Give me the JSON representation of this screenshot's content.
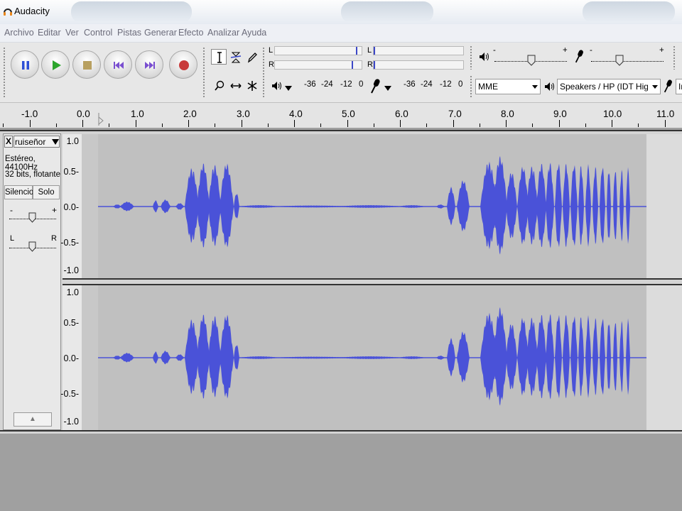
{
  "window": {
    "title": "Audacity"
  },
  "menu": [
    "Archivo",
    "Editar",
    "Ver",
    "Control",
    "Pistas",
    "Generar",
    "Efecto",
    "Analizar",
    "Ayuda"
  ],
  "meters": {
    "play_scale": [
      "-36",
      "-24",
      "-12",
      "0"
    ],
    "rec_scale": [
      "-36",
      "-24",
      "-12",
      "0"
    ],
    "left_label": "L",
    "right_label": "R"
  },
  "mixer": {
    "out_minus": "-",
    "out_plus": "+",
    "in_minus": "-",
    "in_plus": "+"
  },
  "devices": {
    "host": "MME",
    "output": "Speakers / HP (IDT High Defini",
    "input": "Ir"
  },
  "timeline": {
    "labels": [
      "-1.0",
      "0.0",
      "1.0",
      "2.0",
      "3.0",
      "4.0",
      "5.0",
      "6.0",
      "7.0",
      "8.0",
      "9.0",
      "10.0",
      "11.0"
    ]
  },
  "track": {
    "close": "X",
    "name": "ruiseñor",
    "info1": "Estéreo, 44100Hz",
    "info2": "32 bits, flotante",
    "mute": "Silencio",
    "solo": "Solo",
    "gain_minus": "-",
    "gain_plus": "+",
    "pan_left": "L",
    "pan_right": "R",
    "collapse": "▲",
    "scale": [
      "1.0",
      "0.5-",
      "0.0-",
      "-0.5-",
      "-1.0"
    ]
  },
  "colors": {
    "waveform": "#4a52d8",
    "wave_bg": "#c0c0c0"
  }
}
